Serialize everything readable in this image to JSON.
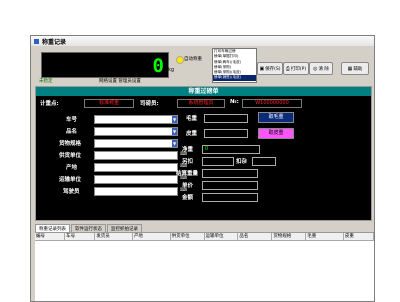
{
  "window": {
    "title": "称重记录"
  },
  "scale": {
    "value": "0",
    "unit": "kg",
    "auto_label": "自动称重"
  },
  "status": {
    "text": "未稳定",
    "links": "网络设置 管理员设置"
  },
  "dropdown": {
    "items": [
      "打印车辆过磅",
      "磅单(单据打印)",
      "磅单(两车)(毛皮)",
      "磅单(采购)",
      "磅单(采购)(毛皮)",
      "磅单(销售)(毛皮)"
    ],
    "selected_index": 5
  },
  "toolbar": {
    "save": "保存(S)",
    "print": "打印(P)",
    "clear": "清 除",
    "help": "辅助"
  },
  "panel": {
    "title": "称重过磅单",
    "ticket_label": "计重点:",
    "ticket_value": "标准称重",
    "operator_label": "司磅员:",
    "operator_value": "系统管理员",
    "no_label": "№:",
    "no_value": "W100000000"
  },
  "left_fields": [
    "车号",
    "品名",
    "货物规格",
    "供货单位",
    "产地",
    "运输单位",
    "驾驶员"
  ],
  "right_fields": {
    "gross": "毛重",
    "tare": "皮重",
    "net": "净重",
    "net_value": "0",
    "extra": "另扣",
    "deduct": "扣杂",
    "settle": "结算重量",
    "price": "单价",
    "amount": "金额"
  },
  "buttons": {
    "take_gross": "取毛重",
    "take_tare": "取皮重"
  },
  "tabs": [
    "称重记录列表",
    "软件运行状态",
    "监控抓拍记录"
  ],
  "grid_columns": [
    "编号",
    "车号",
    "发货员",
    "产地",
    "供货单位",
    "运输单位",
    "品名",
    "货物规格",
    "毛重",
    "皮重"
  ]
}
